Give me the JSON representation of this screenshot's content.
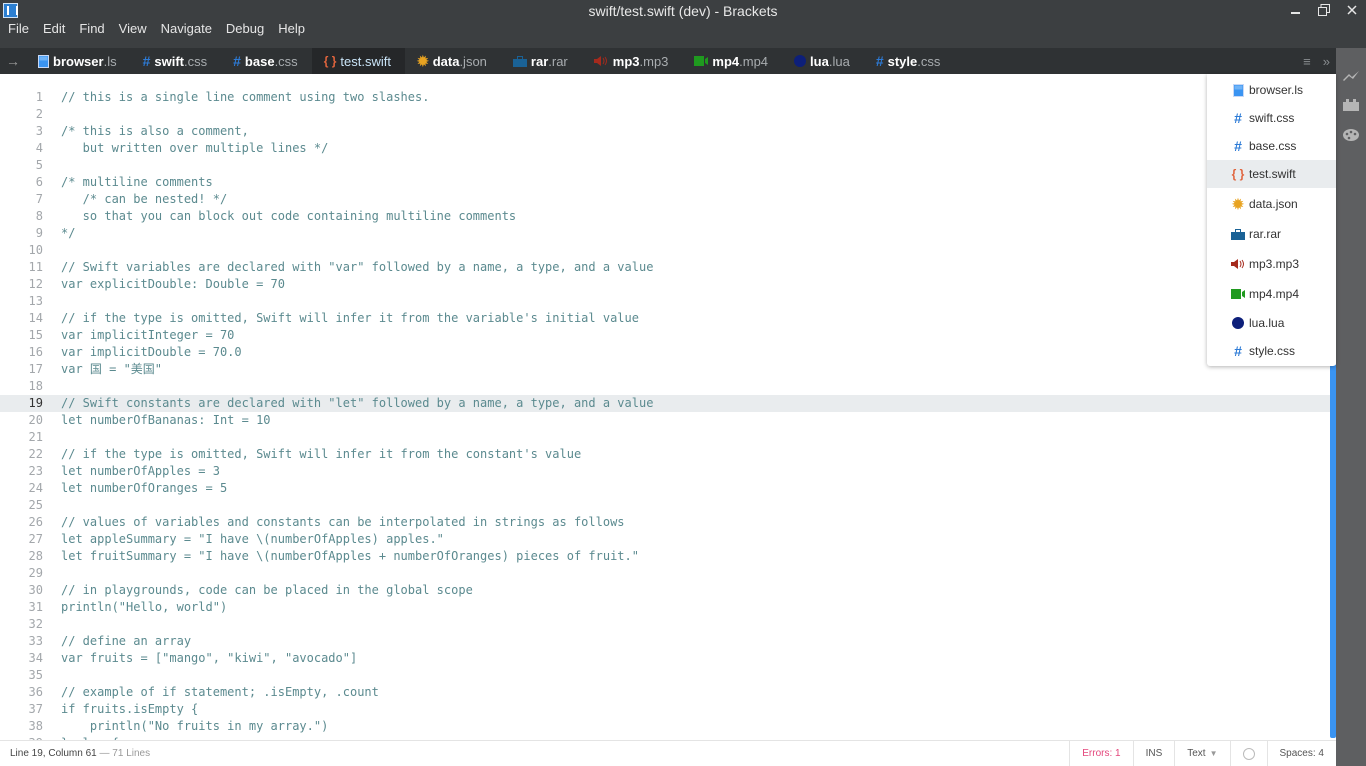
{
  "window": {
    "title": "swift/test.swift (dev) - Brackets",
    "controls": [
      "minimize",
      "maximize",
      "close"
    ]
  },
  "menu": [
    "File",
    "Edit",
    "Find",
    "View",
    "Navigate",
    "Debug",
    "Help"
  ],
  "tabs": [
    {
      "name": "browser",
      "ext": ".ls",
      "icon": "browser-icon",
      "color": "#3a94f2",
      "active": false
    },
    {
      "name": "swift",
      "ext": ".css",
      "icon": "hash-icon",
      "color": "#2d7bd6",
      "active": false
    },
    {
      "name": "base",
      "ext": ".css",
      "icon": "hash-icon",
      "color": "#2d7bd6",
      "active": false
    },
    {
      "name": "test",
      "ext": ".swift",
      "icon": "braces-icon",
      "color": "#e0643d",
      "active": true
    },
    {
      "name": "data",
      "ext": ".json",
      "icon": "gear-icon",
      "color": "#e8a321",
      "active": false
    },
    {
      "name": "rar",
      "ext": ".rar",
      "icon": "briefcase-icon",
      "color": "#1a6296",
      "active": false
    },
    {
      "name": "mp3",
      "ext": ".mp3",
      "icon": "speaker-icon",
      "color": "#a52a1d",
      "active": false
    },
    {
      "name": "mp4",
      "ext": ".mp4",
      "icon": "video-icon",
      "color": "#1f9a1f",
      "active": false
    },
    {
      "name": "lua",
      "ext": ".lua",
      "icon": "circle-icon",
      "color": "#0d1f7a",
      "active": false
    },
    {
      "name": "style",
      "ext": ".css",
      "icon": "hash-icon",
      "color": "#2d7bd6",
      "active": false
    }
  ],
  "tab_tools": {
    "list": "≡",
    "overflow": "»"
  },
  "dropdown": [
    {
      "label": "browser.ls",
      "icon": "browser-icon",
      "active": false
    },
    {
      "label": "swift.css",
      "icon": "hash-icon",
      "active": false
    },
    {
      "label": "base.css",
      "icon": "hash-icon",
      "active": false
    },
    {
      "label": "test.swift",
      "icon": "braces-icon",
      "active": true
    },
    {
      "label": "data.json",
      "icon": "gear-icon",
      "active": false
    },
    {
      "label": "rar.rar",
      "icon": "briefcase-icon",
      "active": false
    },
    {
      "label": "mp3.mp3",
      "icon": "speaker-icon",
      "active": false
    },
    {
      "label": "mp4.mp4",
      "icon": "video-icon",
      "active": false
    },
    {
      "label": "lua.lua",
      "icon": "circle-icon",
      "active": false
    },
    {
      "label": "style.css",
      "icon": "hash-icon",
      "active": false
    }
  ],
  "editor": {
    "active_line": 19,
    "lines": [
      "// this is a single line comment using two slashes.",
      "",
      "/* this is also a comment,",
      "   but written over multiple lines */",
      "",
      "/* multiline comments",
      "   /* can be nested! */",
      "   so that you can block out code containing multiline comments",
      "*/",
      "",
      "// Swift variables are declared with \"var\" followed by a name, a type, and a value",
      "var explicitDouble: Double = 70",
      "",
      "// if the type is omitted, Swift will infer it from the variable's initial value",
      "var implicitInteger = 70",
      "var implicitDouble = 70.0",
      "var 国 = \"美国\"",
      "",
      "// Swift constants are declared with \"let\" followed by a name, a type, and a value",
      "let numberOfBananas: Int = 10",
      "",
      "// if the type is omitted, Swift will infer it from the constant's value",
      "let numberOfApples = 3",
      "let numberOfOranges = 5",
      "",
      "// values of variables and constants can be interpolated in strings as follows",
      "let appleSummary = \"I have \\(numberOfApples) apples.\"",
      "let fruitSummary = \"I have \\(numberOfApples + numberOfOranges) pieces of fruit.\"",
      "",
      "// in playgrounds, code can be placed in the global scope",
      "println(\"Hello, world\")",
      "",
      "// define an array",
      "var fruits = [\"mango\", \"kiwi\", \"avocado\"]",
      "",
      "// example of if statement; .isEmpty, .count",
      "if fruits.isEmpty {",
      "    println(\"No fruits in my array.\")",
      "} else {"
    ]
  },
  "status": {
    "position": "Line 19, Column 61",
    "separator": " — ",
    "line_count": "71 Lines",
    "errors": "Errors: 1",
    "mode": "INS",
    "language": "Text",
    "spaces": "Spaces:  4"
  },
  "right_toolbar": [
    "live-preview-icon",
    "extension-manager-icon",
    "theme-palette-icon"
  ]
}
